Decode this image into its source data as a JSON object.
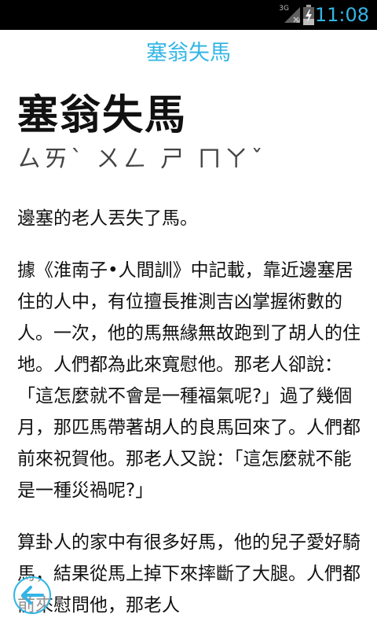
{
  "status_bar": {
    "network_type": "3G",
    "time": "11:08",
    "icons": [
      "signal-icon",
      "battery-charging-icon"
    ],
    "clock_color": "#33b5e5"
  },
  "app_bar": {
    "title": "塞翁失馬"
  },
  "article": {
    "title": "塞翁失馬",
    "zhuyin": "ㄙㄞˋ ㄨㄥ ㄕ ㄇㄚˇ",
    "summary": "邊塞的老人丟失了馬。",
    "paragraph1": "據《淮南子•人間訓》中記載，靠近邊塞居住的人中，有位擅長推測吉凶掌握術數的人。一次，他的馬無緣無故跑到了胡人的住地。人們都為此來寬慰他。那老人卻說：「這怎麼就不會是一種福氣呢?」過了幾個月，那匹馬帶著胡人的良馬回來了。人們都前來祝賀他。那老人又說：「這怎麼就不能是一種災禍呢?」",
    "paragraph2": "算卦人的家中有很多好馬，他的兒子愛好騎馬，結果從馬上掉下來摔斷了大腿。人們都前來慰問他，那老人"
  },
  "controls": {
    "back_icon": "back-arrow-icon",
    "accent_color": "#33b5e5"
  }
}
